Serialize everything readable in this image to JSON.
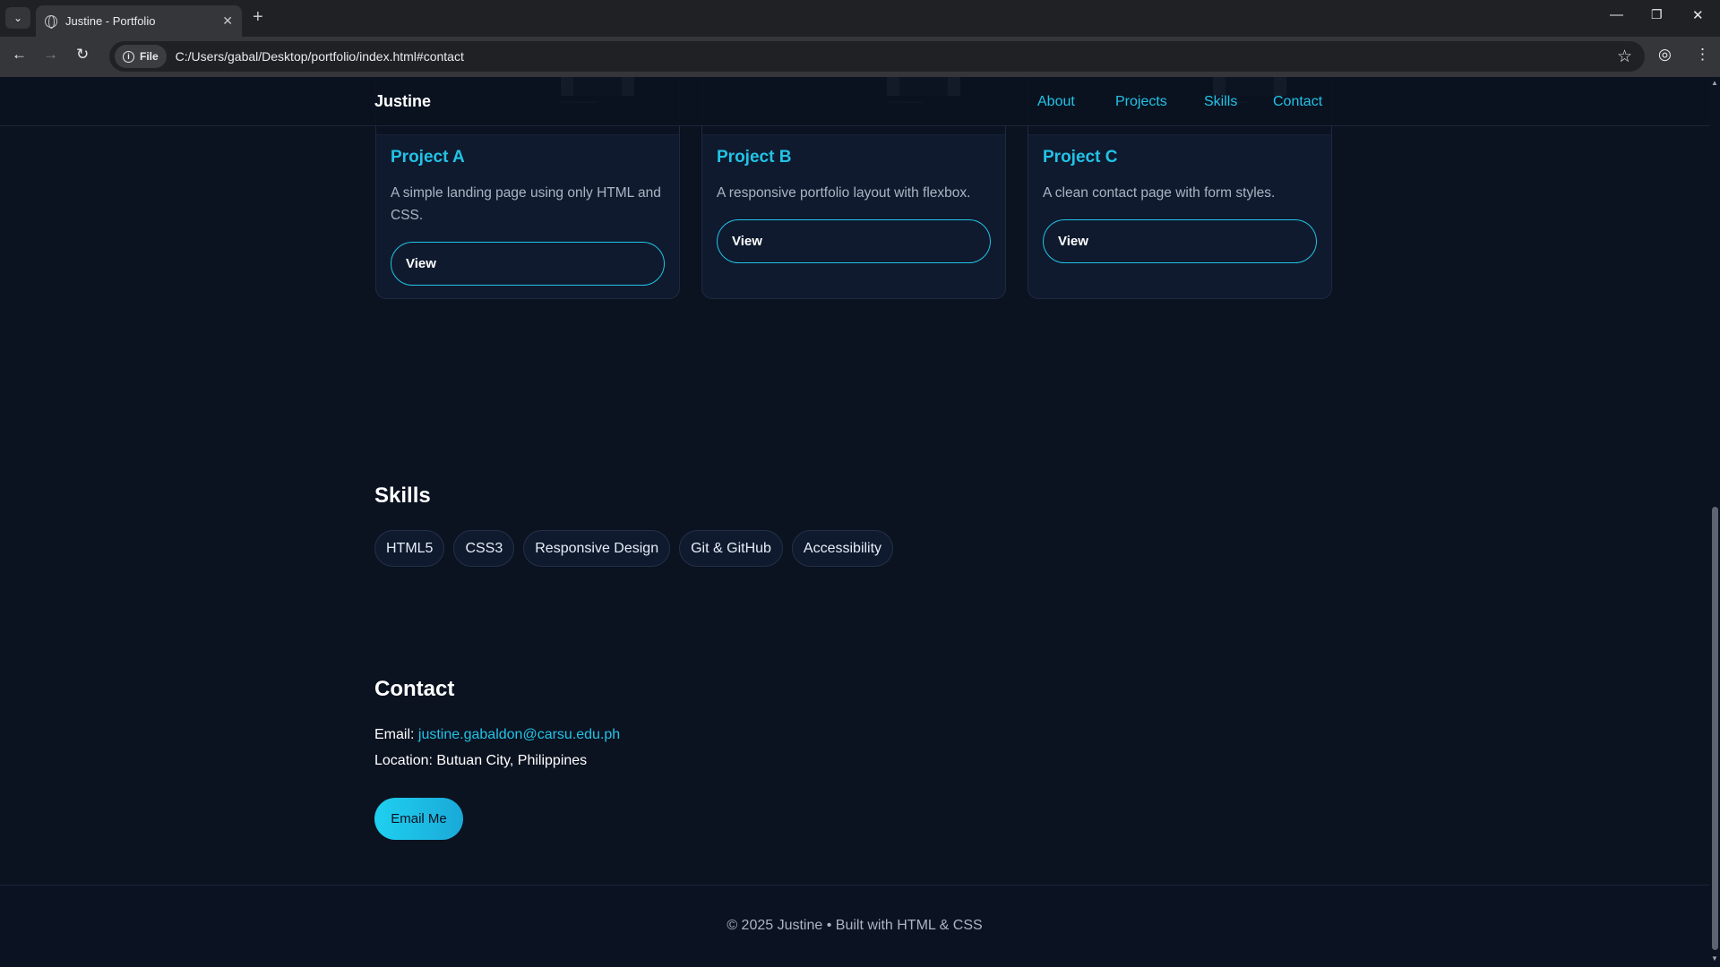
{
  "browser": {
    "tab_title": "Justine - Portfolio",
    "tab_close": "✕",
    "new_tab": "+",
    "chip_label": "File",
    "url": "C:/Users/gabal/Desktop/portfolio/index.html#contact"
  },
  "header": {
    "brand": "Justine",
    "nav": [
      "About",
      "Projects",
      "Skills",
      "Contact"
    ]
  },
  "projects": [
    {
      "title": "Project A",
      "description": "A simple landing page using only HTML and CSS.",
      "button": "View"
    },
    {
      "title": "Project B",
      "description": "A responsive portfolio layout with flexbox.",
      "button": "View"
    },
    {
      "title": "Project C",
      "description": "A clean contact page with form styles.",
      "button": "View"
    }
  ],
  "skills": {
    "title": "Skills",
    "items": [
      "HTML5",
      "CSS3",
      "Responsive Design",
      "Git & GitHub",
      "Accessibility"
    ]
  },
  "contact": {
    "title": "Contact",
    "email_label": "Email:",
    "email": "justine.gabaldon@carsu.edu.ph",
    "location": "Location: Butuan City, Philippines",
    "button": "Email Me"
  },
  "footer": {
    "text": "© 2025 Justine • Built with HTML & CSS"
  },
  "colors": {
    "accent": "#22c3e6",
    "background": "#0b1220",
    "card": "#0f1a2e"
  }
}
